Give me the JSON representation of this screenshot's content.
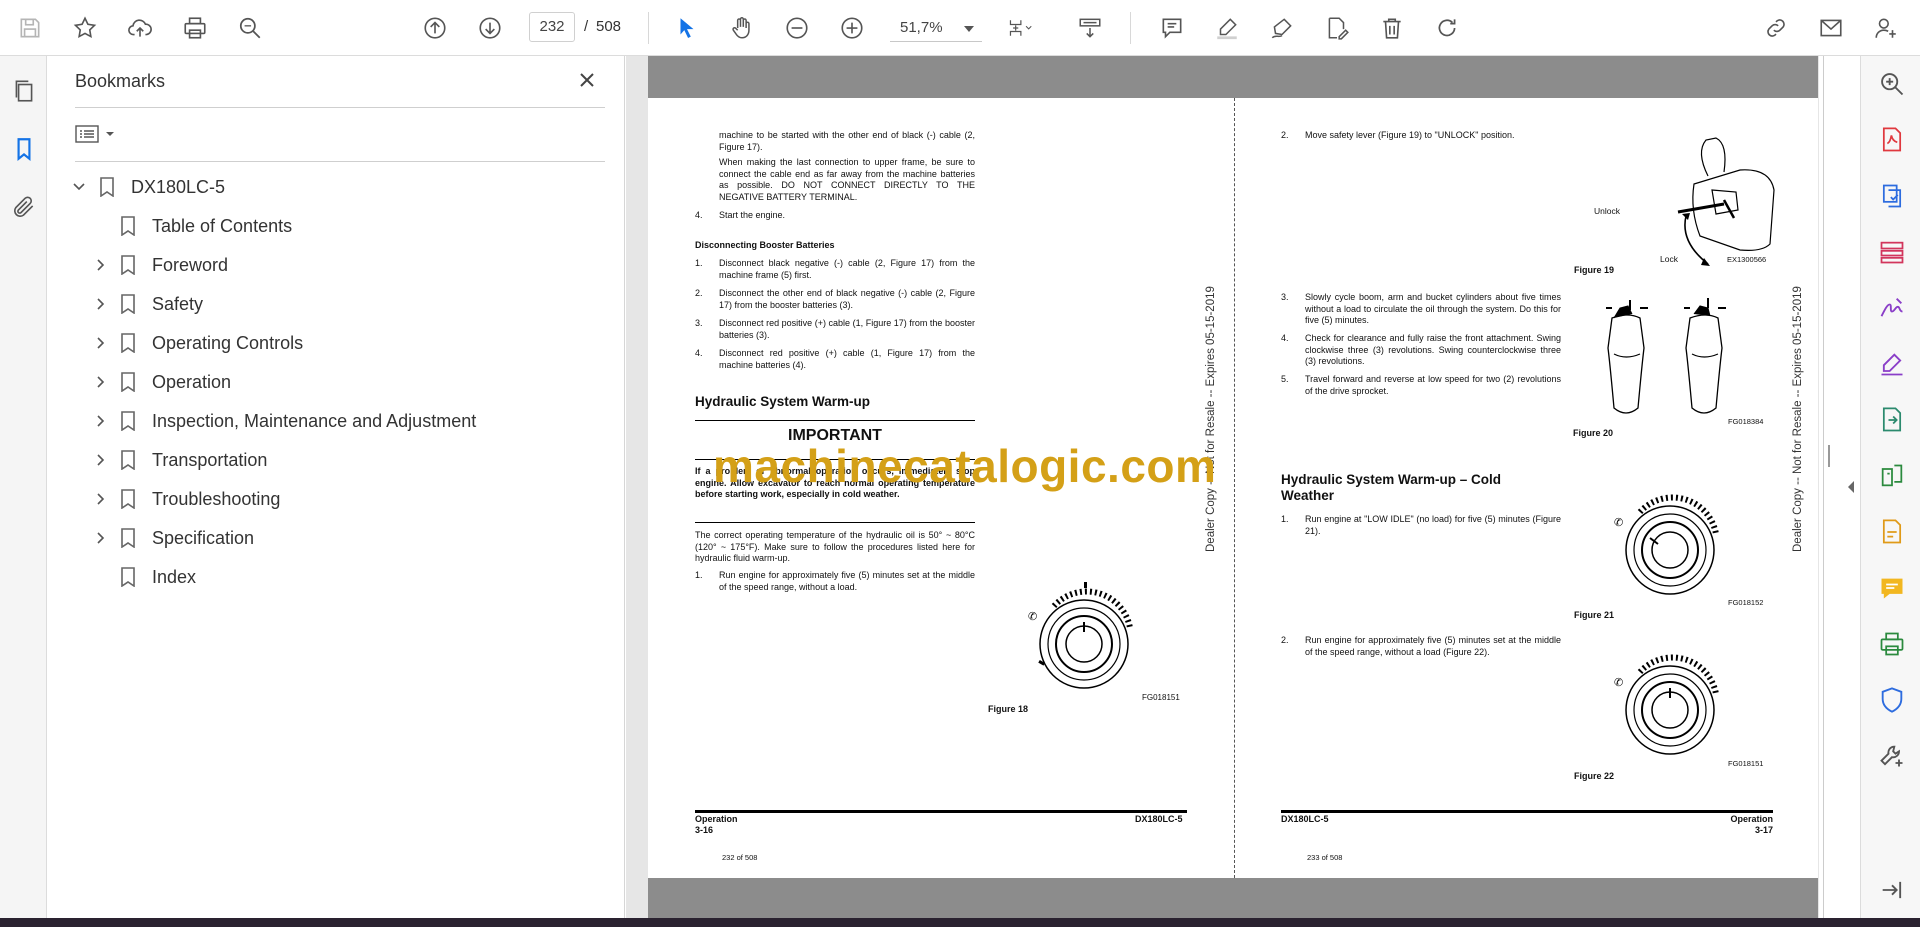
{
  "toolbar": {
    "current_page": "232",
    "page_separator": "/",
    "total_pages": "508",
    "zoom": "51,7%",
    "accent": "#1473e6"
  },
  "left_rail": {
    "icons": [
      "pages-icon",
      "bookmark-icon",
      "attachment-icon"
    ]
  },
  "bookmarks": {
    "title": "Bookmarks",
    "root": "DX180LC-5",
    "items": [
      {
        "label": "Table of Contents",
        "expandable": false
      },
      {
        "label": "Foreword",
        "expandable": true
      },
      {
        "label": "Safety",
        "expandable": true
      },
      {
        "label": "Operating Controls",
        "expandable": true
      },
      {
        "label": "Operation",
        "expandable": true
      },
      {
        "label": "Inspection, Maintenance and Adjustment",
        "expandable": true
      },
      {
        "label": "Transportation",
        "expandable": true
      },
      {
        "label": "Troubleshooting",
        "expandable": true
      },
      {
        "label": "Specification",
        "expandable": true
      },
      {
        "label": "Index",
        "expandable": false
      }
    ]
  },
  "page_left": {
    "p1": "machine to be started with the other end of black (-) cable (2, Figure 17).",
    "p2": "When making the last connection to upper frame, be sure to connect the cable end as far away from the machine batteries as possible. DO NOT CONNECT DIRECTLY TO THE NEGATIVE BATTERY TERMINAL.",
    "step4_num": "4.",
    "step4": "Start the engine.",
    "disc_heading": "Disconnecting Booster Batteries",
    "disc_steps": [
      {
        "num": "1.",
        "text": "Disconnect black negative (-) cable (2, Figure 17) from the machine frame (5) first."
      },
      {
        "num": "2.",
        "text": "Disconnect the other end of black negative (-) cable (2, Figure 17) from the booster batteries (3)."
      },
      {
        "num": "3.",
        "text": "Disconnect red positive (+) cable (1, Figure 17) from the booster batteries (3)."
      },
      {
        "num": "4.",
        "text": "Disconnect red positive (+) cable (1, Figure 17) from the machine batteries (4)."
      }
    ],
    "warmup_heading": "Hydraulic System Warm-up",
    "important": "IMPORTANT",
    "important_text": "If a problem or abnormal operation occurs, immediately stop engine. Allow excavator to reach normal operating temperature before starting work, especially in cold weather.",
    "temp_text": "The correct operating temperature of the hydraulic oil is 50° ~ 80°C (120° ~ 175°F). Make sure to follow the procedures listed here for hydraulic fluid warm-up.",
    "step1_num": "1.",
    "step1": "Run engine for approximately five (5) minutes set at the middle of the speed range, without a load.",
    "fig18_code": "FG018151",
    "fig18_caption": "Figure 18",
    "footer_left_1": "Operation",
    "footer_left_2": "3-16",
    "footer_right": "DX180LC-5",
    "page_count": "232 of 508",
    "vertical_text": "Dealer Copy -- Not for Resale -- Expires 05-15-2019"
  },
  "page_right": {
    "step2_num": "2.",
    "step2": "Move safety lever (Figure 19) to \"UNLOCK\" position.",
    "fig19_unlock": "Unlock",
    "fig19_lock": "Lock",
    "fig19_code": "EX1300566",
    "fig19_caption": "Figure 19",
    "steps": [
      {
        "num": "3.",
        "text": "Slowly cycle boom, arm and bucket cylinders about five times without a load to circulate the oil through the system. Do this for five (5) minutes."
      },
      {
        "num": "4.",
        "text": "Check for clearance and fully raise the front attachment. Swing clockwise three (3) revolutions. Swing counterclockwise three (3) revolutions."
      },
      {
        "num": "5.",
        "text": "Travel forward and reverse at low speed for two (2) revolutions of the drive sprocket."
      }
    ],
    "fig20_code": "FG018384",
    "fig20_caption": "Figure 20",
    "cold_heading": "Hydraulic System Warm-up – Cold Weather",
    "cold1_num": "1.",
    "cold1": "Run engine at \"LOW IDLE\" (no load) for five (5) minutes (Figure 21).",
    "fig21_code": "FG018152",
    "fig21_caption": "Figure 21",
    "cold2_num": "2.",
    "cold2": "Run engine for approximately five (5) minutes set at the middle of the speed range, without a load (Figure 22).",
    "fig22_code": "FG018151",
    "fig22_caption": "Figure 22",
    "footer_left": "DX180LC-5",
    "footer_right_1": "Operation",
    "footer_right_2": "3-17",
    "page_count": "233 of 508",
    "vertical_text": "Dealer Copy -- Not for Resale -- Expires 05-15-2019"
  },
  "watermark": "machinecatalogic.com",
  "right_rail": {
    "icons": [
      "zoom-search-icon",
      "export-pdf-icon",
      "create-pdf-icon",
      "organize-pages-icon",
      "fill-sign-icon",
      "edit-pdf-icon",
      "export-convert-icon",
      "compare-icon",
      "comment-file-icon",
      "comment-icon",
      "print-production-icon",
      "protect-icon",
      "more-tools-icon",
      "expand-panel-icon"
    ]
  }
}
